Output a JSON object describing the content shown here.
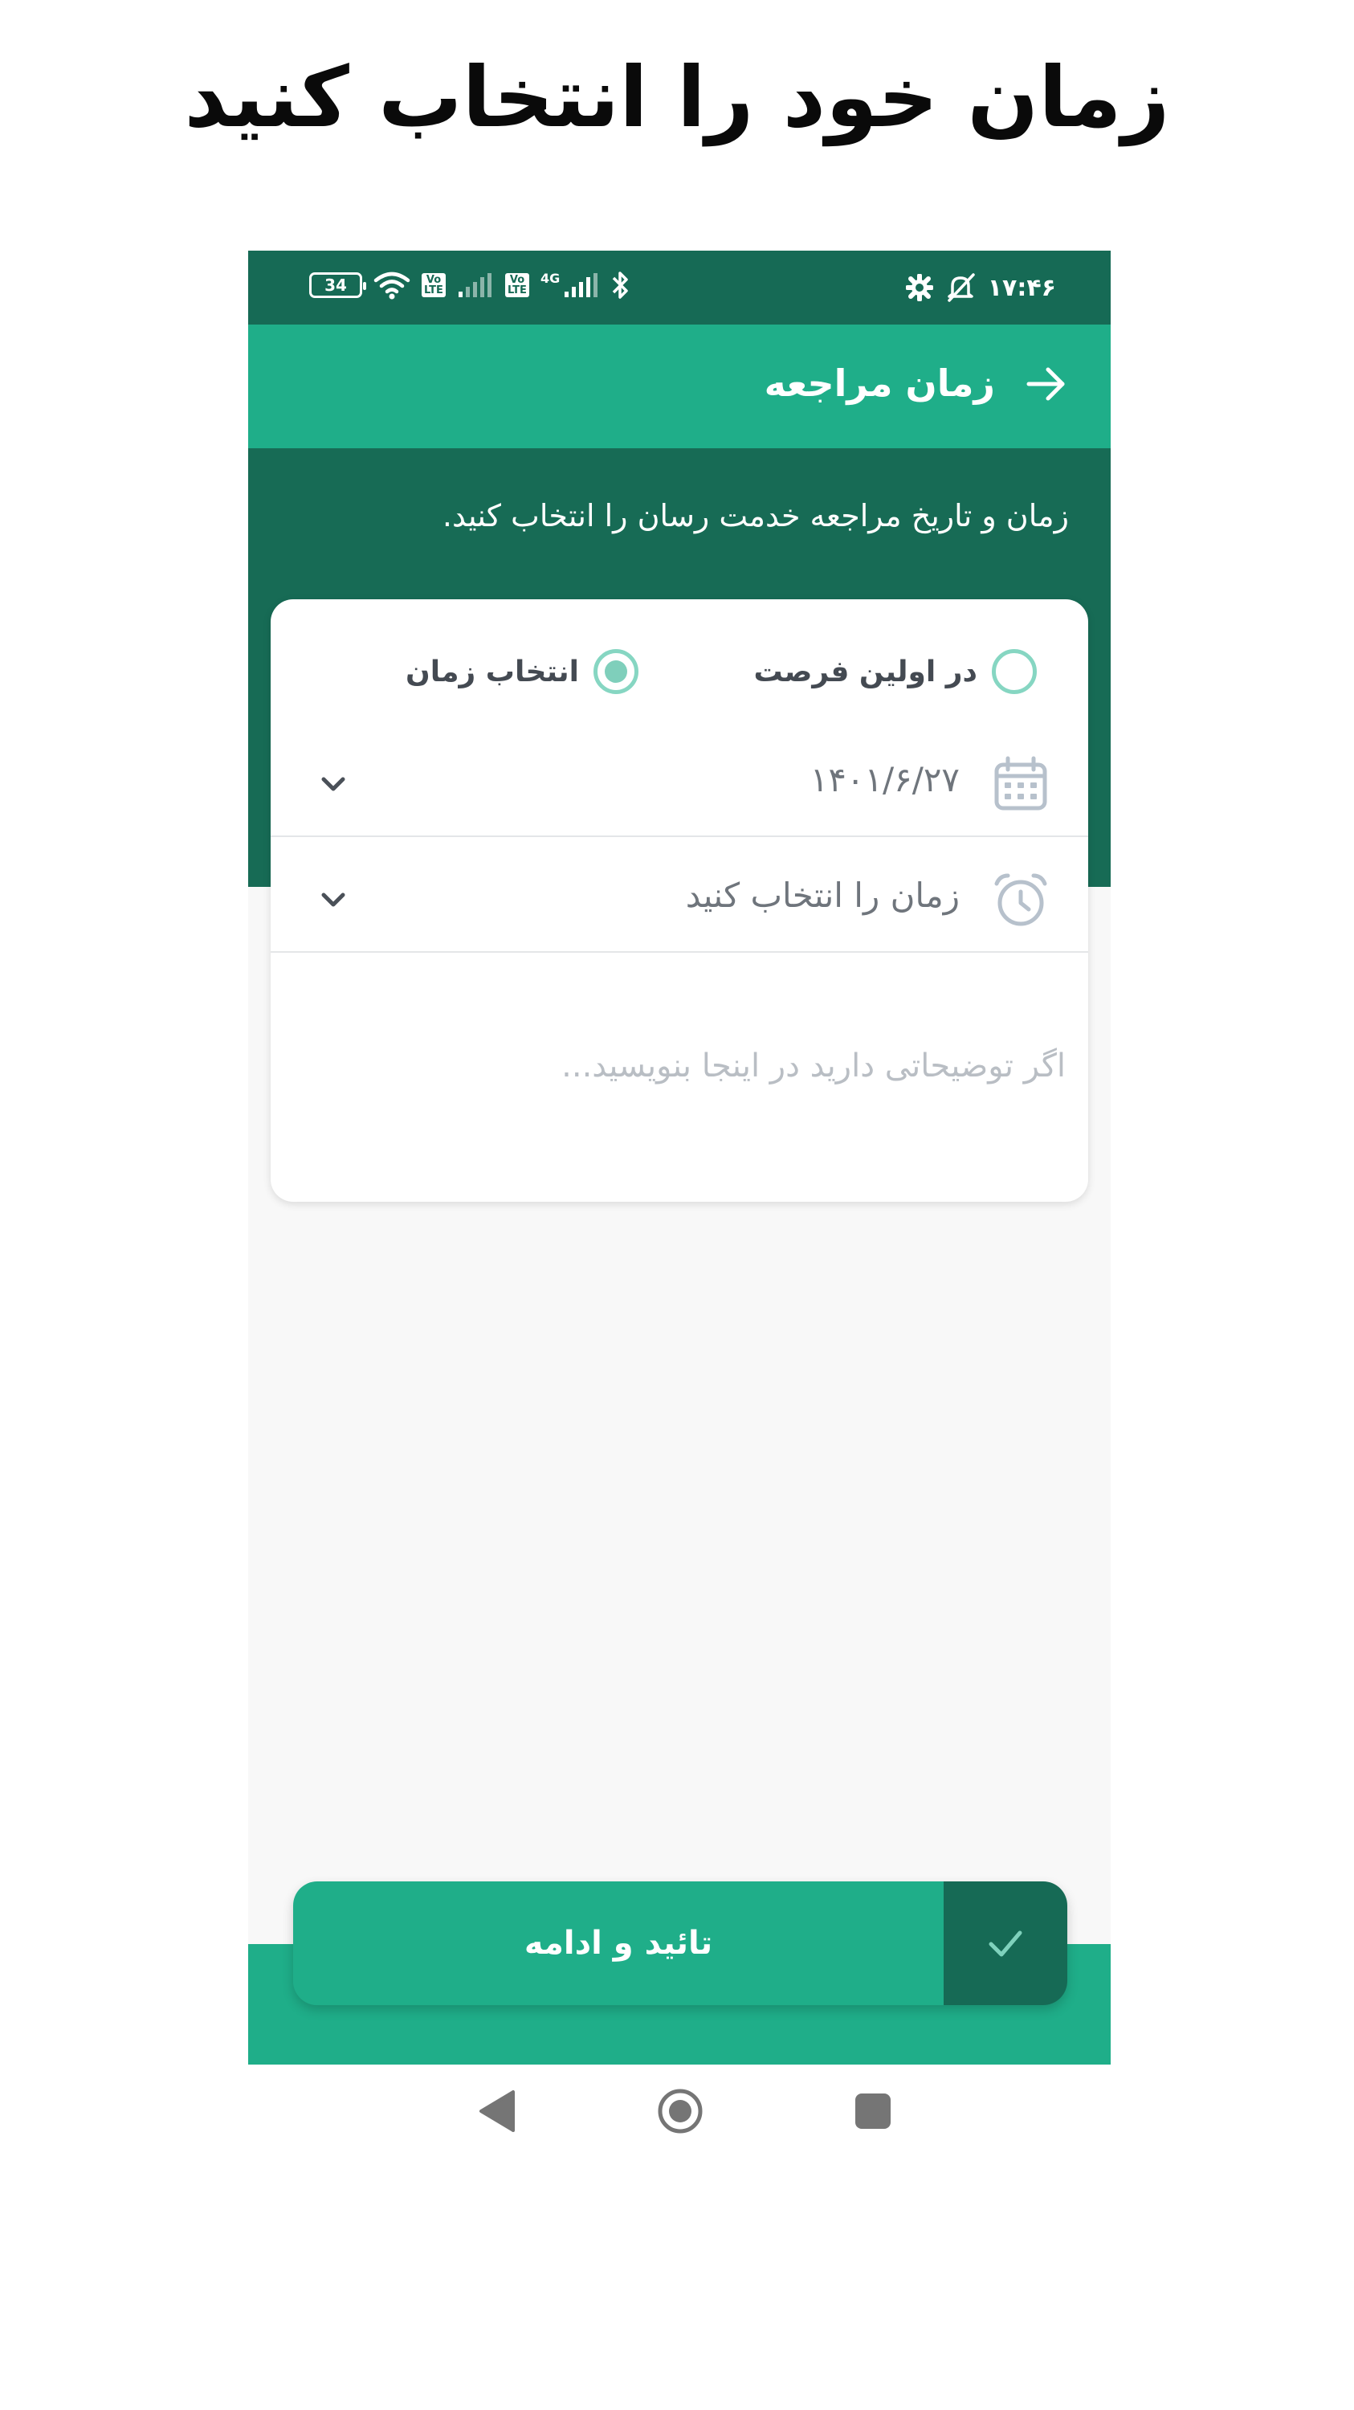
{
  "promo": {
    "title": "زمان خود را انتخاب کنید"
  },
  "status_bar": {
    "time": "۱۷:۴۶",
    "battery": "34",
    "net_tag_1": "Vo LTE",
    "net_tag_2": "Vo LTE",
    "net_label": "4G"
  },
  "app_bar": {
    "title": "زمان مراجعه"
  },
  "header": {
    "description": "زمان و تاریخ مراجعه خدمت رسان را انتخاب کنید."
  },
  "options": {
    "asap_label": "در اولین فرصت",
    "choose_time_label": "انتخاب زمان",
    "selected": "choose_time"
  },
  "date_field": {
    "value": "۱۴۰۱/۶/۲۷"
  },
  "time_field": {
    "value": "زمان را انتخاب کنید"
  },
  "notes_field": {
    "placeholder": "اگر توضیحاتی دارید در اینجا بنویسید..."
  },
  "confirm": {
    "label": "تائید و ادامه"
  },
  "colors": {
    "primary": "#1fae89",
    "primary_dark": "#166a55",
    "radio": "#86d6c2",
    "icon_gray": "#b7c1cc"
  }
}
